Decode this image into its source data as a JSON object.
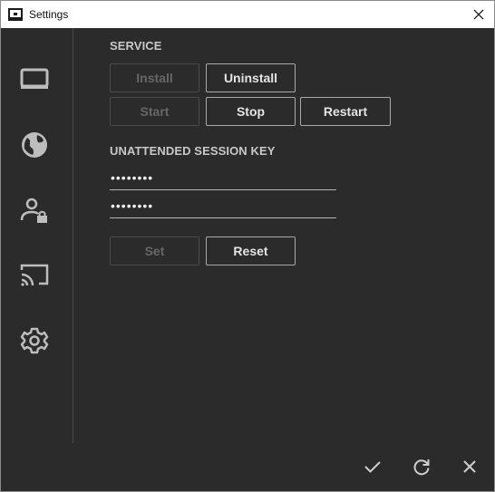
{
  "window": {
    "title": "Settings"
  },
  "sidebar": {
    "items": [
      {
        "icon": "monitor-icon"
      },
      {
        "icon": "globe-icon"
      },
      {
        "icon": "user-lock-icon"
      },
      {
        "icon": "cast-icon"
      },
      {
        "icon": "gear-icon"
      }
    ]
  },
  "service": {
    "heading": "SERVICE",
    "install_label": "Install",
    "uninstall_label": "Uninstall",
    "start_label": "Start",
    "stop_label": "Stop",
    "restart_label": "Restart"
  },
  "session_key": {
    "heading": "UNATTENDED SESSION KEY",
    "key_value": "••••••••",
    "confirm_value": "••••••••",
    "set_label": "Set",
    "reset_label": "Reset"
  },
  "footer": {
    "icons": [
      "check-icon",
      "refresh-icon",
      "close-icon"
    ]
  },
  "colors": {
    "background": "#2b2b2b",
    "text": "#e4e4e4",
    "heading": "#c8c8c8",
    "disabled": "#676767"
  }
}
